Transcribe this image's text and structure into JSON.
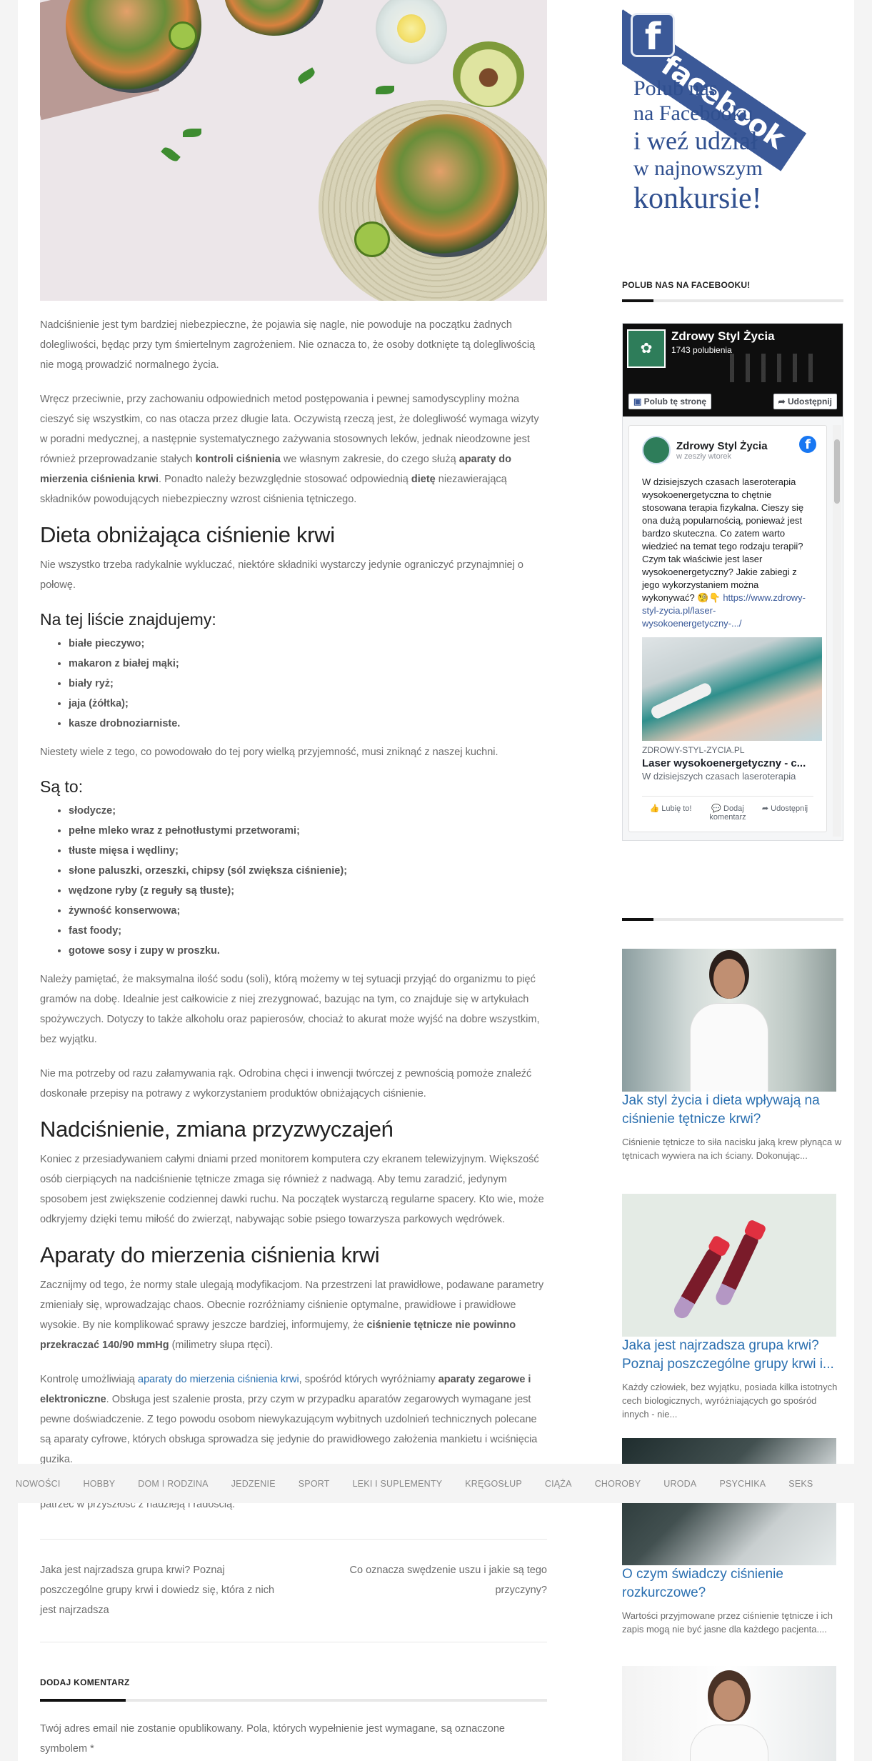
{
  "article": {
    "p1": "Nadciśnienie jest tym bardziej niebezpieczne, że pojawia się nagle, nie powoduje na początku żadnych dolegliwości, będąc przy tym śmiertelnym zagrożeniem. Nie oznacza to, że osoby dotknięte tą dolegliwością nie mogą prowadzić normalnego życia.",
    "p2_a": "Wręcz przeciwnie, przy zachowaniu odpowiednich metod postępowania i pewnej samodyscypliny można cieszyć się wszystkim, co nas otacza przez długie lata. Oczywistą rzeczą jest, że dolegliwość wymaga wizyty w poradni medycznej, a następnie systematycznego zażywania stosownych leków, jednak nieodzowne jest również przeprowadzanie stałych ",
    "p2_b": "kontroli ciśnienia",
    "p2_c": " we własnym zakresie, do czego służą ",
    "p2_d": "aparaty do mierzenia ciśnienia krwi",
    "p2_e": ". Ponadto należy bezwzględnie stosować odpowiednią ",
    "p2_f": "dietę",
    "p2_g": " niezawierającą składników powodujących niebezpieczny wzrost ciśnienia tętniczego.",
    "h2_1": "Dieta obniżająca ciśnienie krwi",
    "p3": "Nie wszystko trzeba radykalnie wykluczać, niektóre składniki wystarczy jedynie ograniczyć przynajmniej o połowę.",
    "h3_1": "Na tej liście znajdujemy:",
    "list1": [
      "białe pieczywo;",
      "makaron z białej mąki;",
      "biały ryż;",
      "jaja (żółtka);",
      "kasze drobnoziarniste."
    ],
    "p4": "Niestety wiele z tego, co powodowało do tej pory wielką przyjemność, musi zniknąć z naszej kuchni.",
    "h3_2": "Są to:",
    "list2": [
      "słodycze;",
      "pełne mleko wraz z pełnotłustymi przetworami;",
      "tłuste mięsa i wędliny;",
      "słone paluszki, orzeszki, chipsy (sól zwiększa ciśnienie);",
      "wędzone ryby (z reguły są tłuste);",
      "żywność konserwowa;",
      "fast foody;",
      "gotowe sosy i zupy w proszku."
    ],
    "p5": "Należy pamiętać, że maksymalna ilość sodu (soli), którą możemy w tej sytuacji przyjąć do organizmu to pięć gramów na dobę. Idealnie jest całkowicie z niej zrezygnować, bazując na tym, co znajduje się w artykułach spożywczych. Dotyczy to także alkoholu oraz papierosów, chociaż to akurat może wyjść na dobre wszystkim, bez wyjątku.",
    "p6": "Nie ma potrzeby od razu załamywania rąk. Odrobina chęci i inwencji twórczej z pewnością pomoże znaleźć doskonałe przepisy na potrawy z wykorzystaniem produktów obniżających ciśnienie.",
    "h2_2": "Nadciśnienie, zmiana przyzwyczajeń",
    "p7": "Koniec z przesiadywaniem całymi dniami przed monitorem komputera czy ekranem telewizyjnym. Większość osób cierpiących na nadciśnienie tętnicze zmaga się również z nadwagą. Aby temu zaradzić, jedynym sposobem jest zwiększenie codziennej dawki ruchu. Na początek wystarczą regularne spacery. Kto wie, może odkryjemy dzięki temu miłość do zwierząt, nabywając sobie psiego towarzysza parkowych wędrówek.",
    "h2_3": "Aparaty do mierzenia ciśnienia krwi",
    "p8_a": "Zacznijmy od tego, że normy stale ulegają modyfikacjom. Na przestrzeni lat prawidłowe, podawane parametry zmieniały się, wprowadzając chaos. Obecnie rozróżniamy ciśnienie optymalne, prawidłowe i prawidłowe wysokie. By nie komplikować sprawy jeszcze bardziej, informujemy, że ",
    "p8_b": "ciśnienie tętnicze nie powinno przekraczać 140/90 mmHg",
    "p8_c": " (milimetry słupa rtęci).",
    "p9_a": "Kontrolę umożliwiają ",
    "p9_link": "aparaty do mierzenia ciśnienia krwi",
    "p9_b": ", spośród których wyróżniamy ",
    "p9_c": "aparaty zegarowe i elektroniczne",
    "p9_d": ". Obsługa jest szalenie prosta, przy czym w przypadku aparatów zegarowych wymagane jest pewne doświadczenie. Z tego powodu osobom niewykazującym wybitnych uzdolnień technicznych polecane są aparaty cyfrowe, których obsługa sprowadza się jedynie do prawidłowego założenia mankietu i wciśnięcia guzika.",
    "p10_end": "patrzeć w przyszłość z nadzieją i radością."
  },
  "post_nav": {
    "prev": "Jaka jest najrzadsza grupa krwi? Poznaj poszczególne grupy krwi i dowiedz się, która z nich jest najrzadsza",
    "next": "Co oznacza swędzenie uszu i jakie są tego przyczyny?"
  },
  "comments": {
    "heading": "DODAJ KOMENTARZ",
    "note": "Twój adres email nie zostanie opublikowany. Pola, których wypełnienie jest wymagane, są oznaczone symbolem *"
  },
  "sidebar": {
    "banner": {
      "ribbon": "facebook",
      "fb_letter": "f",
      "line1": "Polub nas",
      "line2": "na Facebooku",
      "line3": "i weź udział",
      "line4": "w najnowszym",
      "line5": "konkursie!"
    },
    "widget_title": "POLUB NAS NA FACEBOOKU!",
    "fb_page": {
      "name": "Zdrowy Styl Życia",
      "likes": "1743 polubienia",
      "like_btn": "Polub tę stronę",
      "share_btn": "Udostępnij",
      "post_author": "Zdrowy Styl Życia",
      "post_date": "w zeszły wtorek",
      "post_text": "W dzisiejszych czasach laseroterapia wysokoenergetyczna to chętnie stosowana terapia fizykalna. Cieszy się ona dużą popularnością, ponieważ jest bardzo skuteczna. Co zatem warto wiedzieć na temat tego rodzaju terapii? Czym tak właściwie jest laser wysokoenergetyczny? Jakie zabiegi z jego wykorzystaniem można wykonywać? 🧐👇",
      "post_link": "https://www.zdrowy-styl-zycia.pl/laser-wysokoenergetyczny-.../",
      "link_domain": "ZDROWY-STYL-ZYCIA.PL",
      "link_title": "Laser wysokoenergetyczny - c...",
      "link_desc": "W dzisiejszych czasach laseroterapia",
      "action_like": "Lubię to!",
      "action_comment": "Dodaj komentarz",
      "action_share": "Udostępnij"
    },
    "posts": [
      {
        "title": "Jak styl życia i dieta wpływają na ciśnienie tętnicze krwi?",
        "excerpt": "Ciśnienie tętnicze to siła nacisku jaką krew płynąca w tętnicach wywiera na ich ściany. Dokonując..."
      },
      {
        "title": "Jaka jest najrzadsza grupa krwi? Poznaj poszczególne grupy krwi i...",
        "excerpt": "Każdy człowiek, bez wyjątku, posiada kilka istotnych cech biologicznych, wyróżniających go spośród innych - nie..."
      },
      {
        "title": "O czym świadczy ciśnienie rozkurczowe?",
        "excerpt": "Wartości przyjmowane przez ciśnienie tętnicze i ich zapis mogą nie być jasne dla każdego pacjenta...."
      }
    ]
  },
  "nav": [
    "NOWOŚCI",
    "HOBBY",
    "DOM I RODZINA",
    "JEDZENIE",
    "SPORT",
    "LEKI I SUPLEMENTY",
    "KRĘGOSŁUP",
    "CIĄŻA",
    "CHOROBY",
    "URODA",
    "PSYCHIKA",
    "SEKS"
  ],
  "colors": {
    "link": "#2a6fb0",
    "facebook": "#3b5998",
    "heading": "#222222",
    "body_text": "#6b6b6b"
  }
}
